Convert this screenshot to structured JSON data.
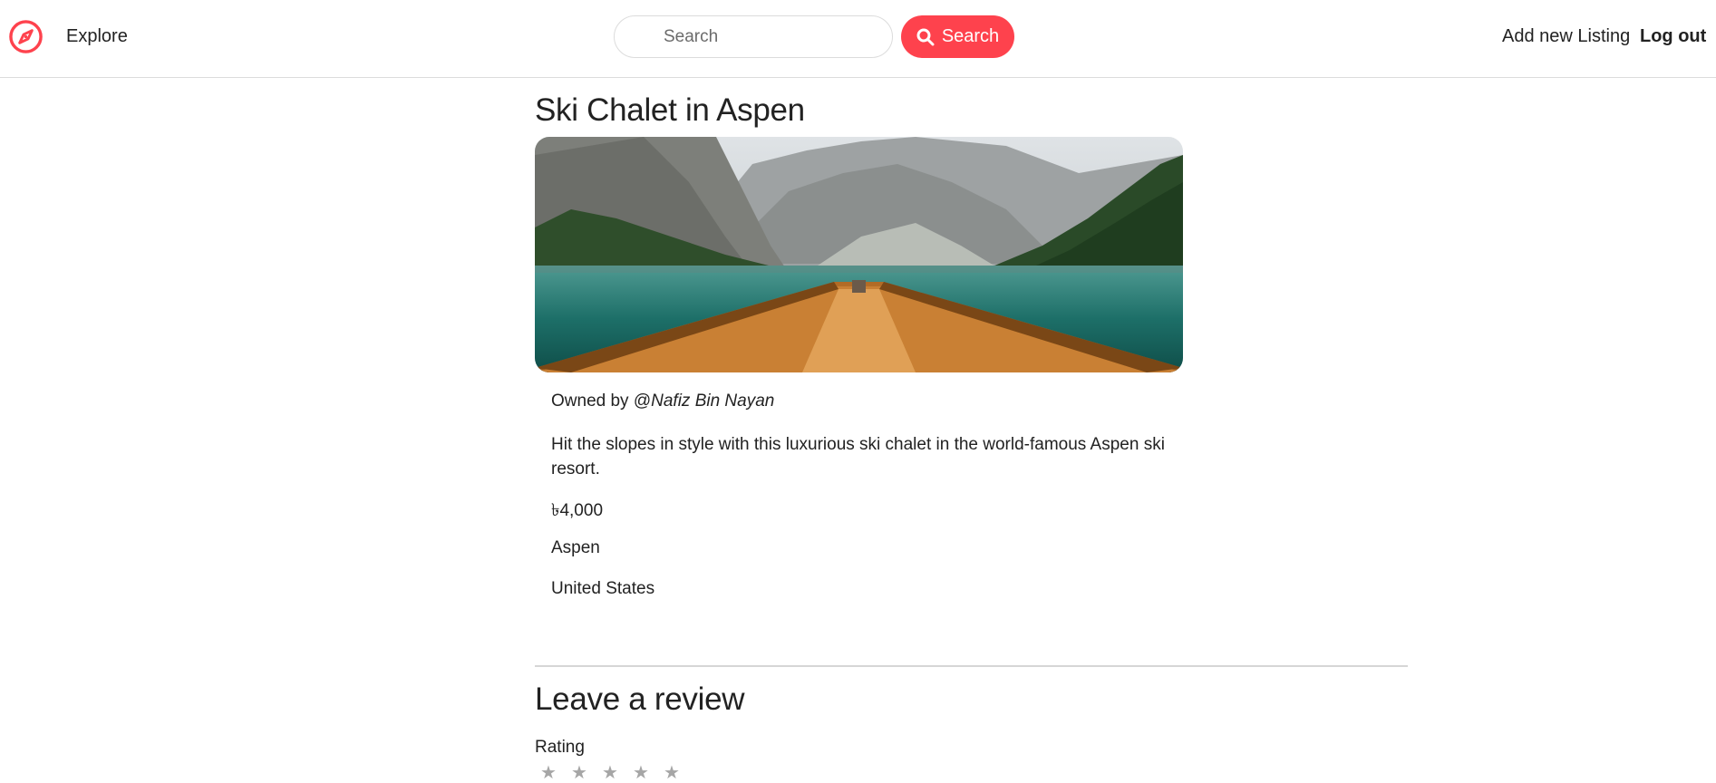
{
  "nav": {
    "explore_label": "Explore",
    "search_placeholder": "Search",
    "search_button_label": "Search",
    "add_listing_label": "Add new Listing",
    "logout_label": "Log out",
    "brand_icon": "compass-icon",
    "accent_color": "#fe424d"
  },
  "listing": {
    "title": "Ski Chalet in Aspen",
    "image": "lake-boat-mountains-photo",
    "owner_prefix": "Owned by @",
    "owner_name": "Nafiz Bin Nayan",
    "description": "Hit the slopes in style with this luxurious ski chalet in the world-famous Aspen ski resort.",
    "price": "৳4,000",
    "location": "Aspen",
    "country": "United States"
  },
  "review": {
    "heading": "Leave a review",
    "rating_label": "Rating",
    "stars": [
      "star-icon",
      "star-icon",
      "star-icon",
      "star-icon",
      "star-icon"
    ]
  }
}
